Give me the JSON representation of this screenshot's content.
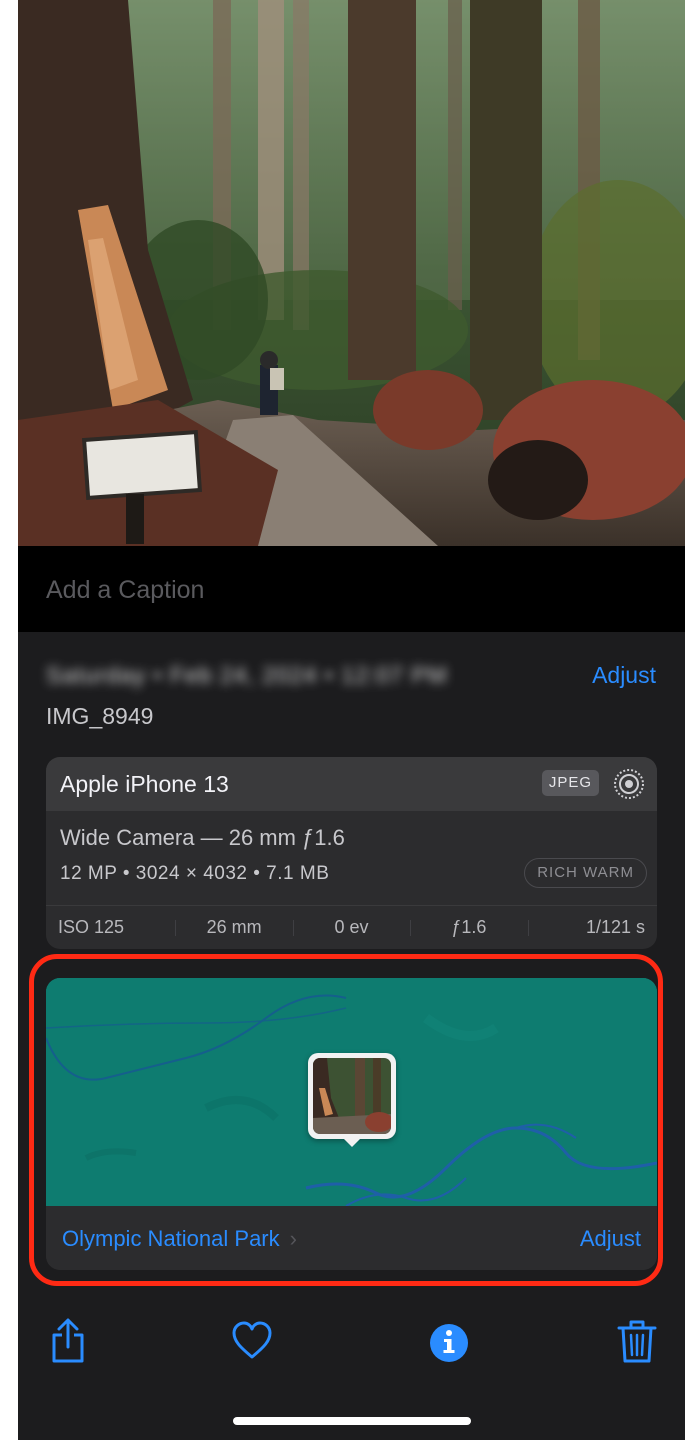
{
  "caption": {
    "placeholder": "Add a Caption"
  },
  "info": {
    "date_time": "Saturday • Feb 24, 2024 • 12:07 PM",
    "adjust_label": "Adjust",
    "filename": "IMG_8949"
  },
  "exif": {
    "device": "Apple iPhone 13",
    "format_badge": "JPEG",
    "lens": "Wide Camera — 26 mm ƒ1.6",
    "specs": "12 MP  •  3024 × 4032  •  7.1 MB",
    "style_badge": "RICH WARM",
    "values": [
      "ISO 125",
      "26 mm",
      "0 ev",
      "ƒ1.6",
      "1/121 s"
    ]
  },
  "location": {
    "place_name": "Olympic National Park",
    "chevron": "›",
    "adjust_label": "Adjust"
  },
  "toolbar": {
    "icons": [
      "share-icon",
      "heart-icon",
      "info-icon",
      "trash-icon"
    ]
  },
  "colors": {
    "accent": "#2a8cff",
    "highlight": "#ff2a14",
    "map": "#0e7c70",
    "background": "#1c1c1e"
  }
}
